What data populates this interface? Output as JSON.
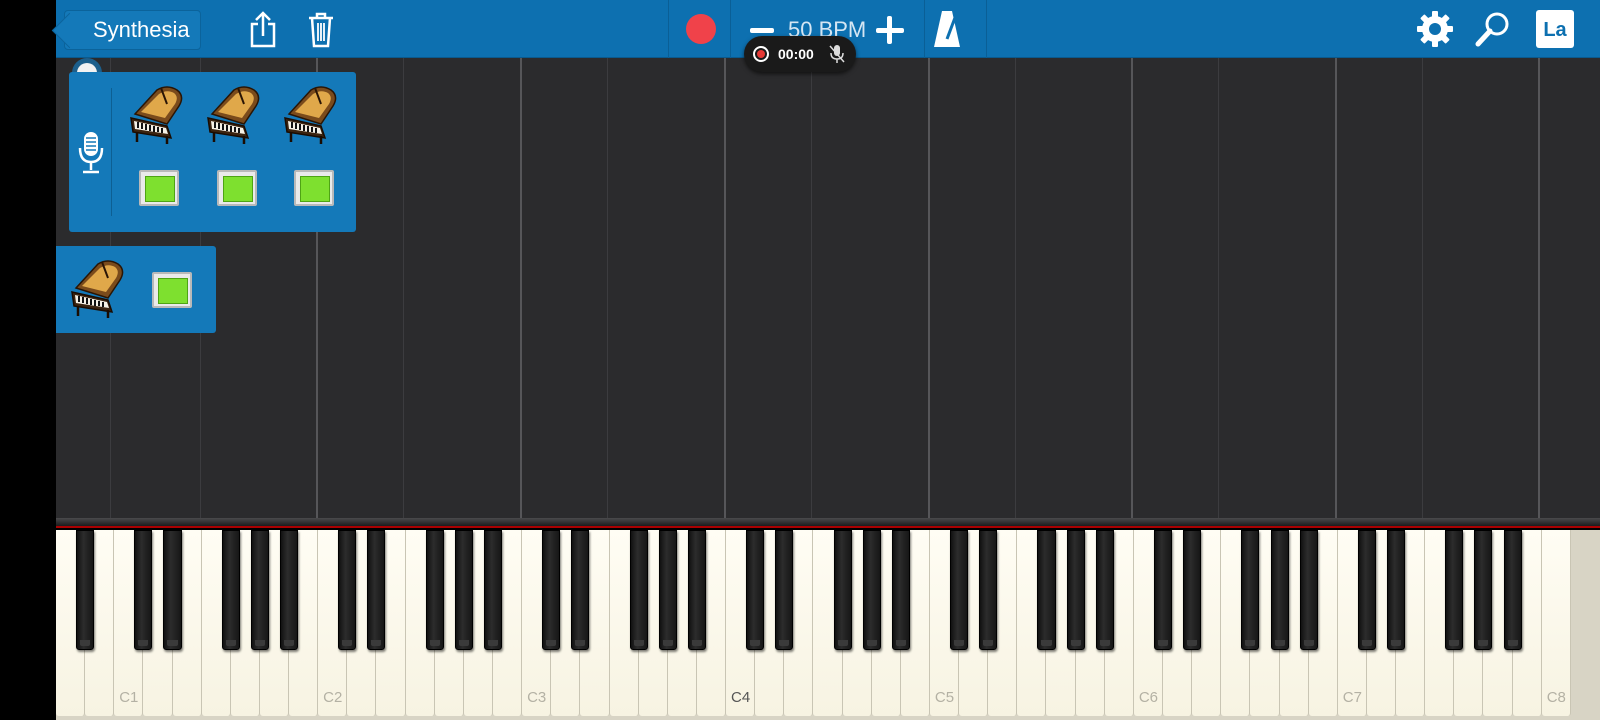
{
  "toolbar": {
    "back_label": "Synthesia",
    "bpm_label": "50 BPM",
    "lang_label": "La",
    "icons": [
      "share-icon",
      "trash-icon",
      "record-icon",
      "minus-icon",
      "plus-icon",
      "metronome-icon",
      "gear-icon",
      "search-icon"
    ]
  },
  "recording": {
    "time": "00:00"
  },
  "keyboard": {
    "octave_labels": [
      "C1",
      "C2",
      "C3",
      "C4",
      "C5",
      "C6",
      "C7",
      "C8"
    ],
    "highlighted_label": "C4"
  },
  "colors": {
    "toolbar": "#0d70b0",
    "panel": "#1479b9",
    "note_area": "#2b2b2d",
    "toggle_on": "#7ee02f",
    "record_red": "#f0424a"
  }
}
